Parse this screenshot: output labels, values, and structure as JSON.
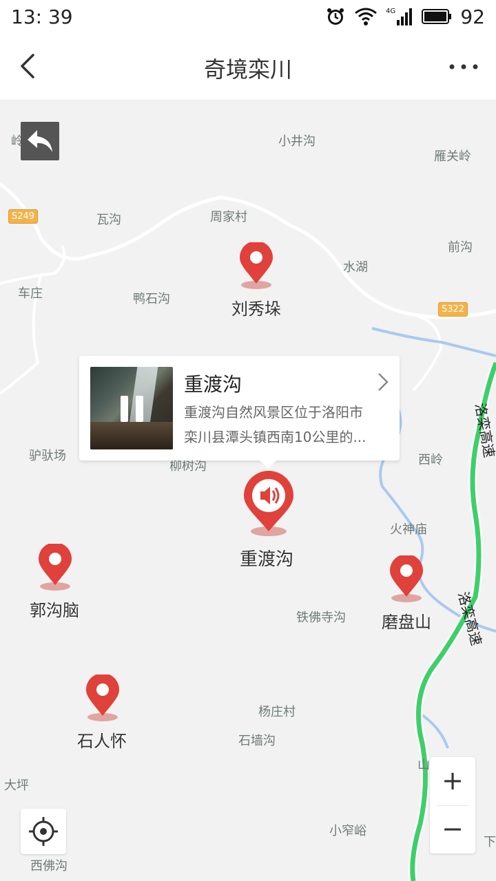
{
  "status_bar": {
    "time": "13: 39",
    "network": "4G",
    "battery": "92"
  },
  "header": {
    "title": "奇境栾川"
  },
  "map": {
    "places": [
      {
        "name": "岭",
        "key": "lingtop"
      },
      {
        "name": "小井沟"
      },
      {
        "name": "雁关岭"
      },
      {
        "name": "瓦沟"
      },
      {
        "name": "周家村"
      },
      {
        "name": "前沟"
      },
      {
        "name": "水湖"
      },
      {
        "name": "车庄"
      },
      {
        "name": "鸭石沟"
      },
      {
        "name": "驴驮场"
      },
      {
        "name": "柳树沟"
      },
      {
        "name": "西岭"
      },
      {
        "name": "火神庙"
      },
      {
        "name": "铁佛寺沟"
      },
      {
        "name": "杨庄村"
      },
      {
        "name": "石墙沟"
      },
      {
        "name": "大坪"
      },
      {
        "name": "小窄峪"
      },
      {
        "name": "西佛沟"
      },
      {
        "name": "山"
      },
      {
        "name": "下"
      }
    ],
    "road_badges": [
      "S249",
      "S322"
    ],
    "highway_labels": [
      "洛栾高速",
      "洛栾高速"
    ],
    "pins": [
      {
        "label": "刘秀垛"
      },
      {
        "label": "重渡沟"
      },
      {
        "label": "郭沟脑"
      },
      {
        "label": "磨盘山"
      },
      {
        "label": "石人怀"
      }
    ],
    "accent_color": "#e0413a",
    "highway_color": "#3fcf6a"
  },
  "popup": {
    "title": "重渡沟",
    "desc_line1": "重渡沟自然风景区位于洛阳市",
    "desc_line2": "栾川县潭头镇西南10公里的..."
  },
  "zoom": {
    "in_label": "+",
    "out_label": "−"
  }
}
